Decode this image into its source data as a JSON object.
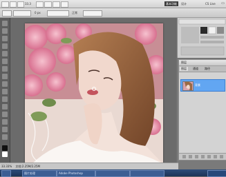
{
  "menubar": {
    "zoom": "33.3",
    "workspace": "基本功能",
    "design": "设计",
    "cs_live": "CS Live"
  },
  "options": {
    "feather": "0 px",
    "style": "正常"
  },
  "status": {
    "zoom": "33.33%",
    "doc": "文档:2.25M/2.25M"
  },
  "layers_panel": {
    "title": "图层",
    "tabs": [
      "图层",
      "通道",
      "路径"
    ],
    "layer_name": "背景"
  },
  "taskbar": {
    "items": [
      "图片处理",
      "Adobe Photoshop",
      "",
      ""
    ]
  },
  "colors": {
    "accent": "#62a6f2",
    "workspace_bg": "#6b6b6b"
  }
}
